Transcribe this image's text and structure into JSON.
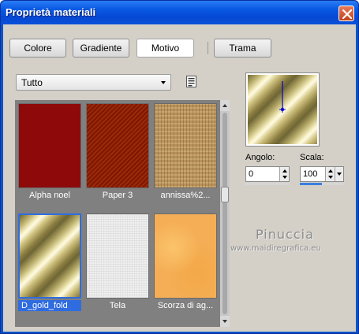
{
  "window": {
    "title": "Proprietà materiali",
    "close_icon": "close-icon"
  },
  "tabs": [
    {
      "label": "Colore",
      "active": false
    },
    {
      "label": "Gradiente",
      "active": false
    },
    {
      "label": "Motivo",
      "active": true
    },
    {
      "label": "Trama",
      "active": false
    }
  ],
  "category": {
    "selected": "Tutto",
    "list_view_icon": "list-view-icon"
  },
  "patterns": [
    {
      "label": "Alpha noel",
      "selected": false
    },
    {
      "label": "Paper 3",
      "selected": false
    },
    {
      "label": "annissa%2...",
      "selected": false
    },
    {
      "label": "D_gold_fold",
      "selected": true
    },
    {
      "label": "Tela",
      "selected": false
    },
    {
      "label": "Scorza di ag...",
      "selected": false
    }
  ],
  "preview": {
    "angle_label": "Angolo:",
    "angle_value": "0",
    "scale_label": "Scala:",
    "scale_value": "100",
    "scale_level": 0.5
  },
  "watermark": {
    "name": "Pinuccia",
    "url": "www.maidiregrafica.eu"
  },
  "colors": {
    "title_bar": "#0a5ae4",
    "dialog_bg": "#d4d0c8",
    "selection": "#2f6ce0",
    "close_button": "#d9542b"
  }
}
